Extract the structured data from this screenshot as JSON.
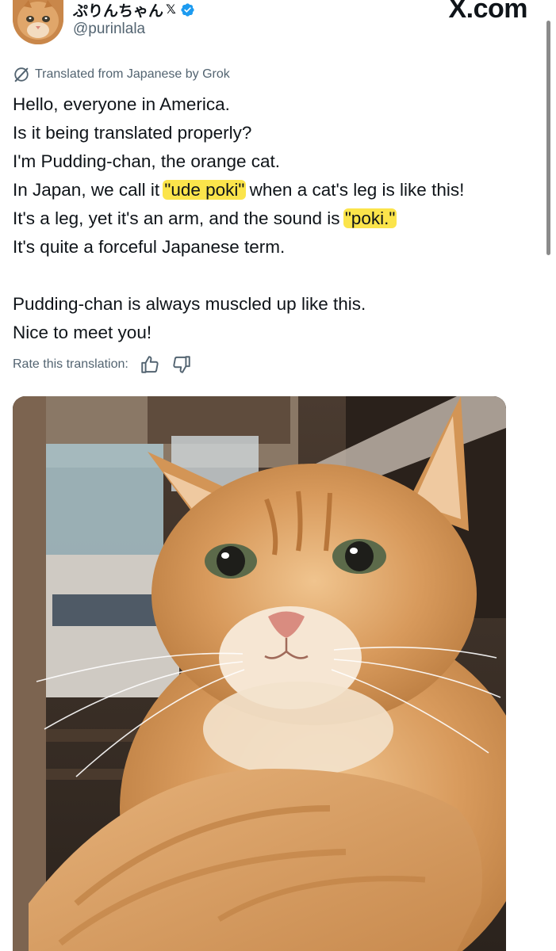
{
  "header": {
    "display_name": "ぷりんちゃん",
    "x_badge": "𝕏",
    "handle": "@purinlala",
    "site": "X.com"
  },
  "translation": {
    "label": "Translated from Japanese by Grok"
  },
  "tweet": {
    "line1": "Hello, everyone in America.",
    "line2": "Is it being translated properly?",
    "line3": "I'm Pudding-chan, the orange cat.",
    "line4_pre": "In Japan, we call it ",
    "line4_hl": "\"ude poki\"",
    "line4_post": " when a cat's leg is like this!",
    "line5_pre": "It's a leg, yet it's an arm, and the sound is ",
    "line5_hl": "\"poki.\"",
    "line6": "It's quite a forceful Japanese term.",
    "line7": "Pudding-chan is always muscled up like this.",
    "line8": "Nice to meet you!"
  },
  "rate": {
    "label": "Rate this translation:",
    "thumbs_up_icon": "thumbs-up-icon",
    "thumbs_down_icon": "thumbs-down-icon"
  },
  "colors": {
    "highlight": "#fbe44b",
    "secondary_text": "#536471",
    "verified_blue": "#1d9bf0"
  }
}
